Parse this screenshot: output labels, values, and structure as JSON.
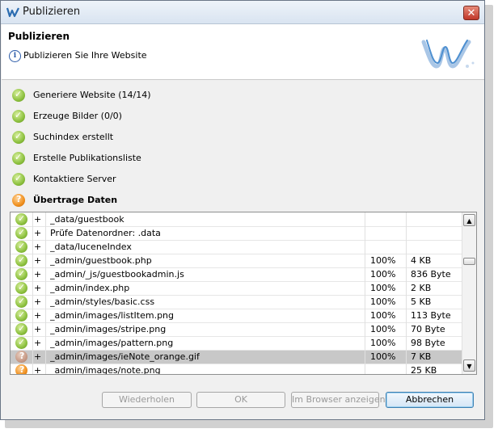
{
  "window": {
    "title": "Publizieren"
  },
  "header": {
    "title": "Publizieren",
    "subtitle": "Publizieren Sie Ihre Website"
  },
  "steps": [
    {
      "label": "Generiere Website (14/14)",
      "status": "done"
    },
    {
      "label": "Erzeuge Bilder (0/0)",
      "status": "done"
    },
    {
      "label": "Suchindex erstellt",
      "status": "done"
    },
    {
      "label": "Erstelle Publikationsliste",
      "status": "done"
    },
    {
      "label": "Kontaktiere Server",
      "status": "done"
    },
    {
      "label": "Übertrage Daten",
      "status": "in-progress"
    }
  ],
  "files": [
    {
      "status": "done",
      "op": "+",
      "path": "_data/guestbook",
      "progress": "",
      "size": ""
    },
    {
      "status": "done",
      "op": "+",
      "path": "Prüfe Datenordner: .data",
      "progress": "",
      "size": ""
    },
    {
      "status": "done",
      "op": "+",
      "path": "_data/luceneIndex",
      "progress": "",
      "size": ""
    },
    {
      "status": "done",
      "op": "+",
      "path": "_admin/guestbook.php",
      "progress": "100%",
      "size": "4 KB"
    },
    {
      "status": "done",
      "op": "+",
      "path": "_admin/_js/guestbookadmin.js",
      "progress": "100%",
      "size": "836 Byte"
    },
    {
      "status": "done",
      "op": "+",
      "path": "_admin/index.php",
      "progress": "100%",
      "size": "2 KB"
    },
    {
      "status": "done",
      "op": "+",
      "path": "_admin/styles/basic.css",
      "progress": "100%",
      "size": "5 KB"
    },
    {
      "status": "done",
      "op": "+",
      "path": "_admin/images/listItem.png",
      "progress": "100%",
      "size": "113 Byte"
    },
    {
      "status": "done",
      "op": "+",
      "path": "_admin/images/stripe.png",
      "progress": "100%",
      "size": "70 Byte"
    },
    {
      "status": "done",
      "op": "+",
      "path": "_admin/images/pattern.png",
      "progress": "100%",
      "size": "98 Byte"
    },
    {
      "status": "pending",
      "op": "+",
      "path": "_admin/images/ieNote_orange.gif",
      "progress": "100%",
      "size": "7 KB",
      "selected": true
    },
    {
      "status": "busy",
      "op": "+",
      "path": "_admin/images/note.png",
      "progress": "",
      "size": "25 KB"
    }
  ],
  "buttons": {
    "retry": "Wiederholen",
    "ok": "OK",
    "browser": "Im Browser anzeigen",
    "cancel": "Abbrechen"
  },
  "colors": {
    "accent": "#3c7fb1",
    "done": "#8dc13f",
    "in_progress": "#f0901e"
  }
}
